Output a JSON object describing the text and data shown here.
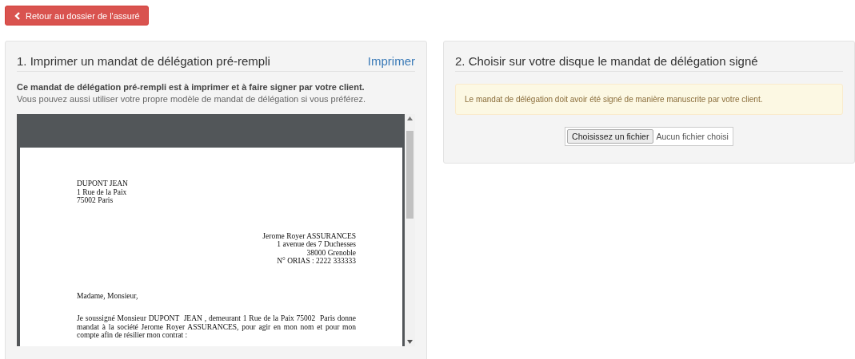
{
  "back_button": {
    "label": "Retour au dossier de l'assuré"
  },
  "panel_print": {
    "title": "1. Imprimer un mandat de délégation pré-rempli",
    "action": "Imprimer",
    "intro_bold": "Ce mandat de délégation pré-rempli est à imprimer et à faire signer par votre client.",
    "intro": "Vous pouvez aussi utiliser votre propre modèle de mandat de délégation si vous préférez.",
    "document": {
      "sender": [
        "DUPONT JEAN",
        "1 Rue de la Paix",
        "75002 Paris"
      ],
      "recipient": [
        "Jerome Royer ASSURANCES",
        "1 avenue des 7 Duchesses",
        "38000 Grenoble",
        "N° ORIAS : 2222 333333"
      ],
      "greeting": "Madame, Monsieur,",
      "body": "Je soussigné Monsieur DUPONT  JEAN , demeurant 1 Rue de la Paix 75002  Paris donne mandat à la société Jerome Royer ASSURANCES, pour agir en mon nom et pour mon compte afin de résilier mon contrat :"
    }
  },
  "panel_upload": {
    "title": "2. Choisir sur votre disque le mandat de délégation signé",
    "alert": "Le mandat de délégation doit avoir été signé de manière manuscrite par votre client.",
    "file_button": "Choisissez un fichier",
    "file_status": "Aucun fichier choisi"
  }
}
